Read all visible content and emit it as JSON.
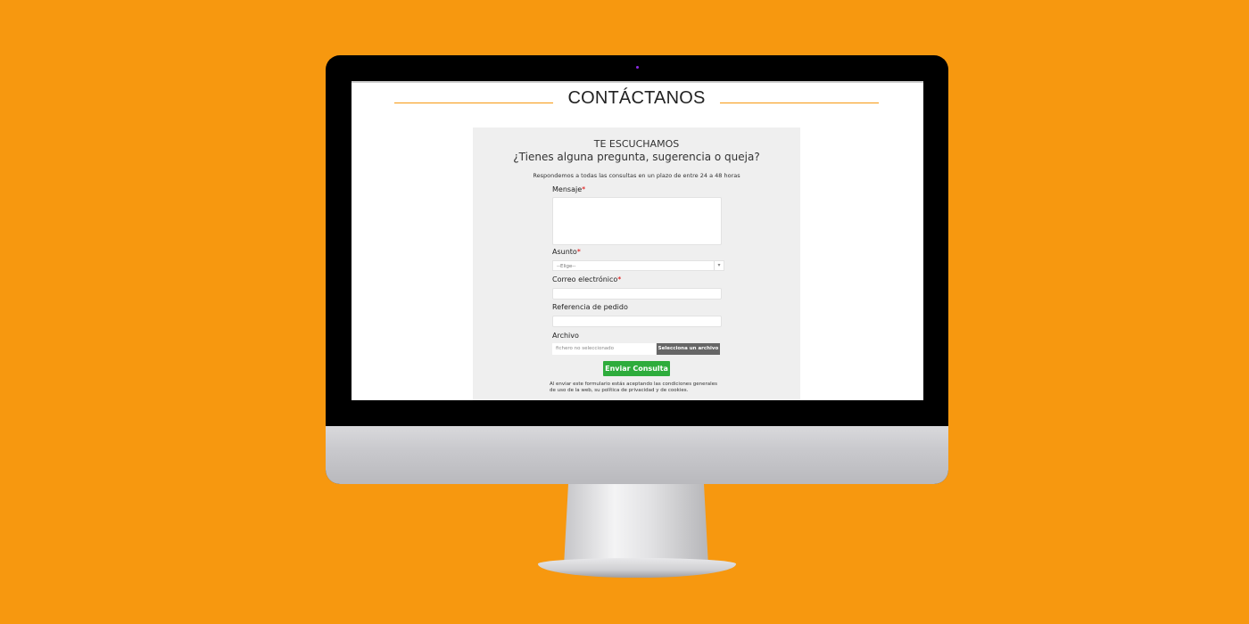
{
  "page": {
    "title": "CONTÁCTANOS"
  },
  "form": {
    "heading_1": "TE ESCUCHAMOS",
    "heading_2": "¿Tienes alguna pregunta, sugerencia o queja?",
    "note": "Respondemos a todas las consultas en un plazo de entre 24 a 48 horas",
    "fields": {
      "message_label": "Mensaje",
      "subject_label": "Asunto",
      "subject_placeholder": "--Elige--",
      "email_label": "Correo electrónico",
      "order_ref_label": "Referencia de pedido",
      "file_label": "Archivo",
      "file_placeholder": "fichero no seleccionado",
      "file_button": "Selecciona un archivo"
    },
    "required_mark": "*",
    "submit_label": "Enviar Consulta",
    "legal_text": "Al enviar este formulario estás aceptando las condiciones generales de uso de la web, su política de privacidad y de cookies."
  },
  "colors": {
    "background": "#f7980f",
    "accent_line": "#f7980f",
    "submit_button": "#2eac3c",
    "file_button": "#666666",
    "required": "#dd0000"
  },
  "icons": {
    "select_arrow": "chevron-down-icon"
  }
}
